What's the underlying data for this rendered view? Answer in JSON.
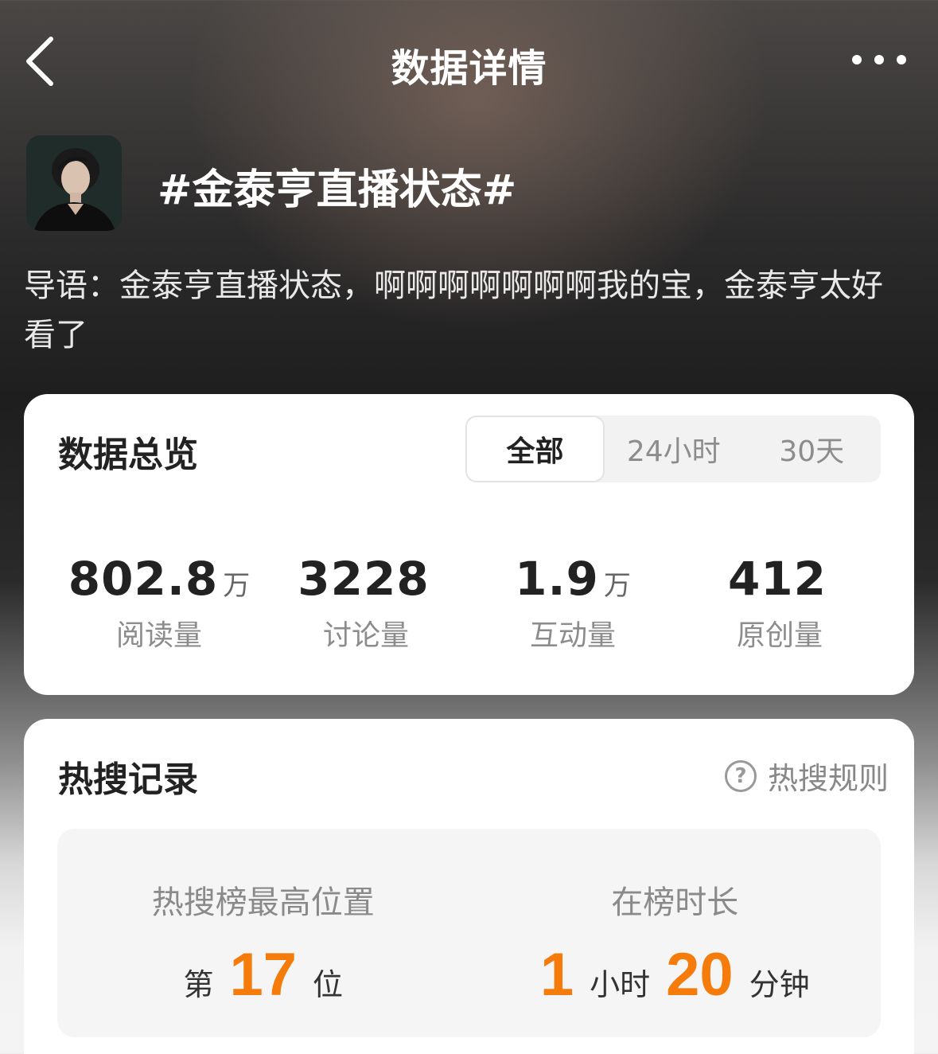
{
  "header": {
    "title": "数据详情",
    "back_icon": "chevron-left-icon",
    "more_icon": "more-dots-icon"
  },
  "topic": {
    "title": "#金泰亨直播状态#",
    "intro": "导语：金泰亨直播状态，啊啊啊啊啊啊啊我的宝，金泰亨太好看了"
  },
  "overview": {
    "title": "数据总览",
    "tabs": [
      {
        "label": "全部",
        "active": true
      },
      {
        "label": "24小时",
        "active": false
      },
      {
        "label": "30天",
        "active": false
      }
    ],
    "stats": [
      {
        "value": "802.8",
        "unit": "万",
        "label": "阅读量"
      },
      {
        "value": "3228",
        "unit": "",
        "label": "讨论量"
      },
      {
        "value": "1.9",
        "unit": "万",
        "label": "互动量"
      },
      {
        "value": "412",
        "unit": "",
        "label": "原创量"
      }
    ]
  },
  "hot_search": {
    "title": "热搜记录",
    "rules_label": "热搜规则",
    "peak": {
      "label": "热搜榜最高位置",
      "prefix": "第",
      "value": "17",
      "suffix": "位"
    },
    "duration": {
      "label": "在榜时长",
      "hours": "1",
      "hours_unit": "小时",
      "minutes": "20",
      "minutes_unit": "分钟"
    }
  },
  "colors": {
    "accent": "#f57b0a"
  }
}
